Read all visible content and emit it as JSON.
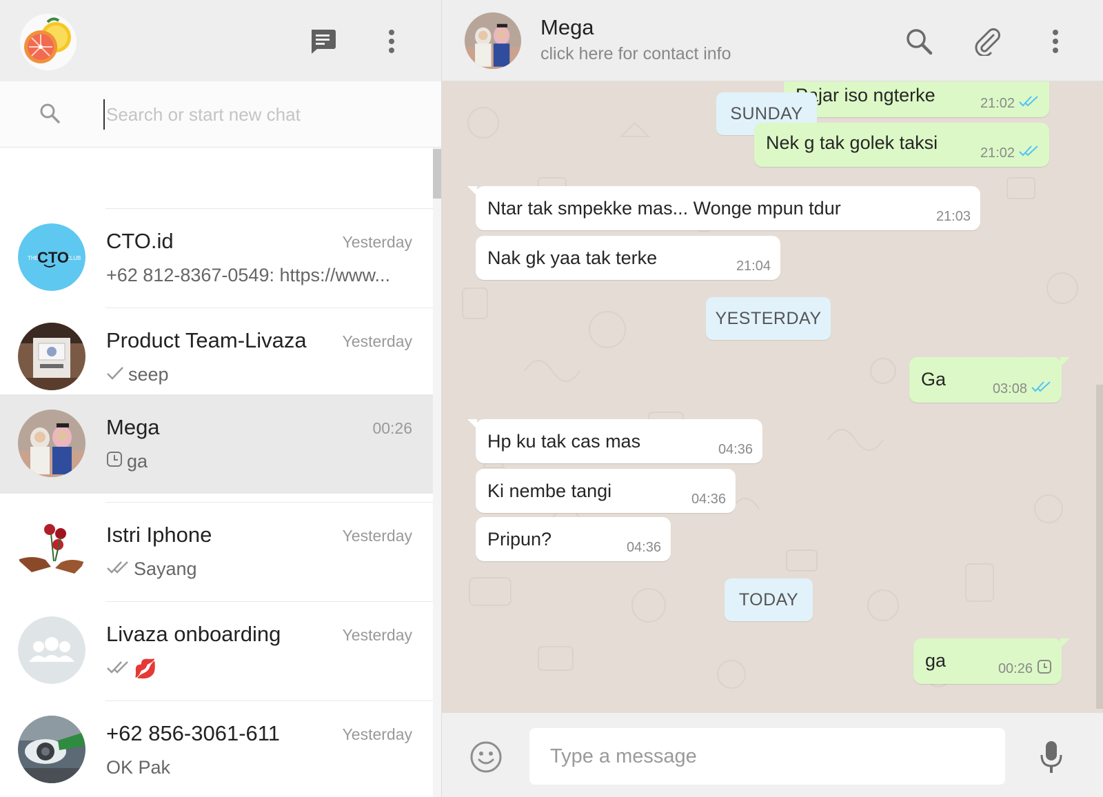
{
  "left_header": {
    "icons": [
      "new-chat-icon",
      "menu-icon"
    ]
  },
  "search": {
    "placeholder": "Search or start new chat",
    "value": ""
  },
  "chats": [
    {
      "name": "CTO.id",
      "time": "Yesterday",
      "preview": "+62 812-8367-0549: https://www...",
      "status_icon": "",
      "avatar": "cto-club-logo"
    },
    {
      "name": "Product Team-Livaza",
      "time": "Yesterday",
      "preview": "seep",
      "status_icon": "single-check-icon",
      "avatar": "group-photo"
    },
    {
      "name": "Mega",
      "time": "00:26",
      "preview": "ga",
      "status_icon": "clock-icon",
      "avatar": "contact-photo",
      "active": true
    },
    {
      "name": "Istri Iphone",
      "time": "Yesterday",
      "preview": "Sayang",
      "status_icon": "double-check-icon",
      "avatar": "roses-photo"
    },
    {
      "name": "Livaza onboarding",
      "time": "Yesterday",
      "preview": "💋",
      "status_icon": "double-check-icon",
      "avatar": "default-group-icon"
    },
    {
      "name": "+62 856-3061-611",
      "time": "Yesterday",
      "preview": "OK Pak",
      "status_icon": "",
      "avatar": "airplane-photo"
    }
  ],
  "contact": {
    "name": "Mega",
    "subtitle": "click here for contact info"
  },
  "days": {
    "sunday": "SUNDAY",
    "yesterday": "YESTERDAY",
    "today": "TODAY"
  },
  "messages": [
    {
      "dir": "out",
      "text": "Pajar iso ngterke",
      "time": "21:02",
      "status": "read"
    },
    {
      "dir": "out",
      "text": "Nek g tak golek taksi",
      "time": "21:02",
      "status": "read"
    },
    {
      "dir": "in",
      "text": "Ntar tak smpekke mas... Wonge mpun tdur",
      "time": "21:03"
    },
    {
      "dir": "in",
      "text": "Nak gk yaa tak terke",
      "time": "21:04"
    },
    {
      "dir": "out",
      "text": "Ga",
      "time": "03:08",
      "status": "read"
    },
    {
      "dir": "in",
      "text": "Hp ku tak cas mas",
      "time": "04:36"
    },
    {
      "dir": "in",
      "text": "Ki nembe tangi",
      "time": "04:36"
    },
    {
      "dir": "in",
      "text": "Pripun?",
      "time": "04:36"
    },
    {
      "dir": "out",
      "text": "ga",
      "time": "00:26",
      "status": "pending"
    }
  ],
  "composer": {
    "placeholder": "Type a message",
    "value": ""
  },
  "colors": {
    "outgoing_bubble": "#dcf8c6",
    "incoming_bubble": "#ffffff",
    "wallpaper": "#e5ddd5",
    "day_pill": "#e1f2fb",
    "read_ticks": "#4fc3f7"
  }
}
